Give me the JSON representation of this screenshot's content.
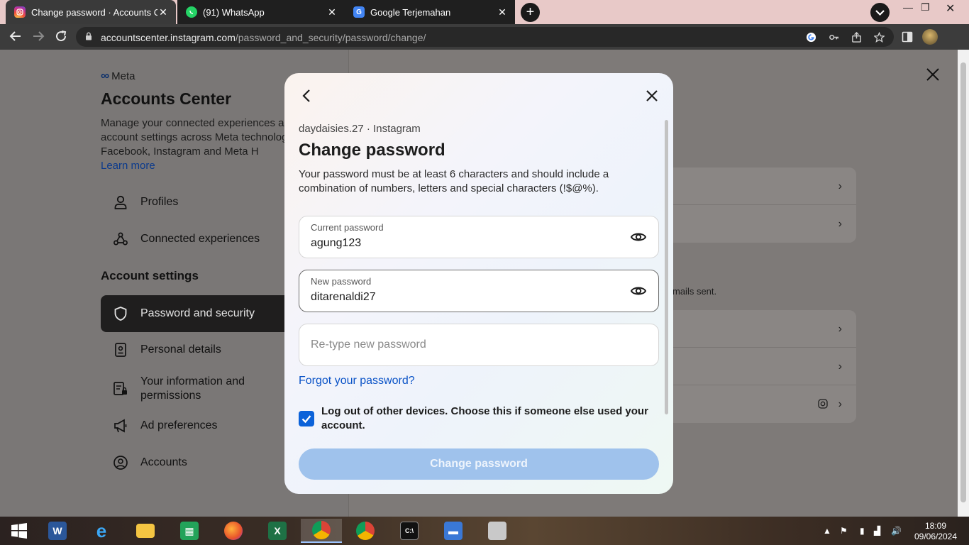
{
  "browser": {
    "tabs": [
      {
        "title": "Change password · Accounts Cen",
        "favicon": "instagram-icon"
      },
      {
        "title": "(91) WhatsApp",
        "favicon": "whatsapp-icon"
      },
      {
        "title": "Google Terjemahan",
        "favicon": "google-translate-icon"
      }
    ],
    "url_domain": "accountscenter.instagram.com",
    "url_path": "/password_and_security/password/change/"
  },
  "page": {
    "brand": "Meta",
    "title": "Accounts Center",
    "description": "Manage your connected experiences and account settings across Meta technologies like Facebook, Instagram and Meta H",
    "learn_more": "Learn more",
    "sidebar_items_top": [
      {
        "label": "Profiles",
        "icon": "person-icon"
      },
      {
        "label": "Connected experiences",
        "icon": "connected-icon"
      }
    ],
    "section_heading": "Account settings",
    "sidebar_items_settings": [
      {
        "label": "Password and security",
        "icon": "shield-icon"
      },
      {
        "label": "Personal details",
        "icon": "id-card-icon"
      },
      {
        "label": "Your information and permissions",
        "icon": "info-lock-icon"
      },
      {
        "label": "Ad preferences",
        "icon": "megaphone-icon"
      },
      {
        "label": "Accounts",
        "icon": "account-circle-icon"
      }
    ],
    "emails_sent_fragment": "mails sent."
  },
  "modal": {
    "account_line": "daydaisies.27 · Instagram",
    "title": "Change password",
    "description": "Your password must be at least 6 characters and should include a combination of numbers, letters and special characters (!$@%).",
    "current_password": {
      "label": "Current password",
      "value": "agung123"
    },
    "new_password": {
      "label": "New password",
      "value": "ditarenaldi27"
    },
    "retype_password": {
      "placeholder": "Re-type new password",
      "value": ""
    },
    "forgot_link": "Forgot your password?",
    "logout_checkbox": {
      "checked": true,
      "label": "Log out of other devices. Choose this if someone else used your account."
    },
    "submit_label": "Change password"
  },
  "taskbar": {
    "time": "18:09",
    "date": "09/06/2024",
    "apps": [
      "windows-start-icon",
      "word-icon",
      "internet-explorer-icon",
      "file-explorer-icon",
      "store-icon",
      "firefox-icon",
      "excel-icon",
      "chrome-profile-icon",
      "chrome-icon",
      "terminal-icon",
      "documents-icon",
      "printer-icon"
    ]
  },
  "colors": {
    "accent_blue": "#0b62d9",
    "submit_disabled": "#9fc2ec",
    "sidebar_active": "#1f1e1e"
  }
}
